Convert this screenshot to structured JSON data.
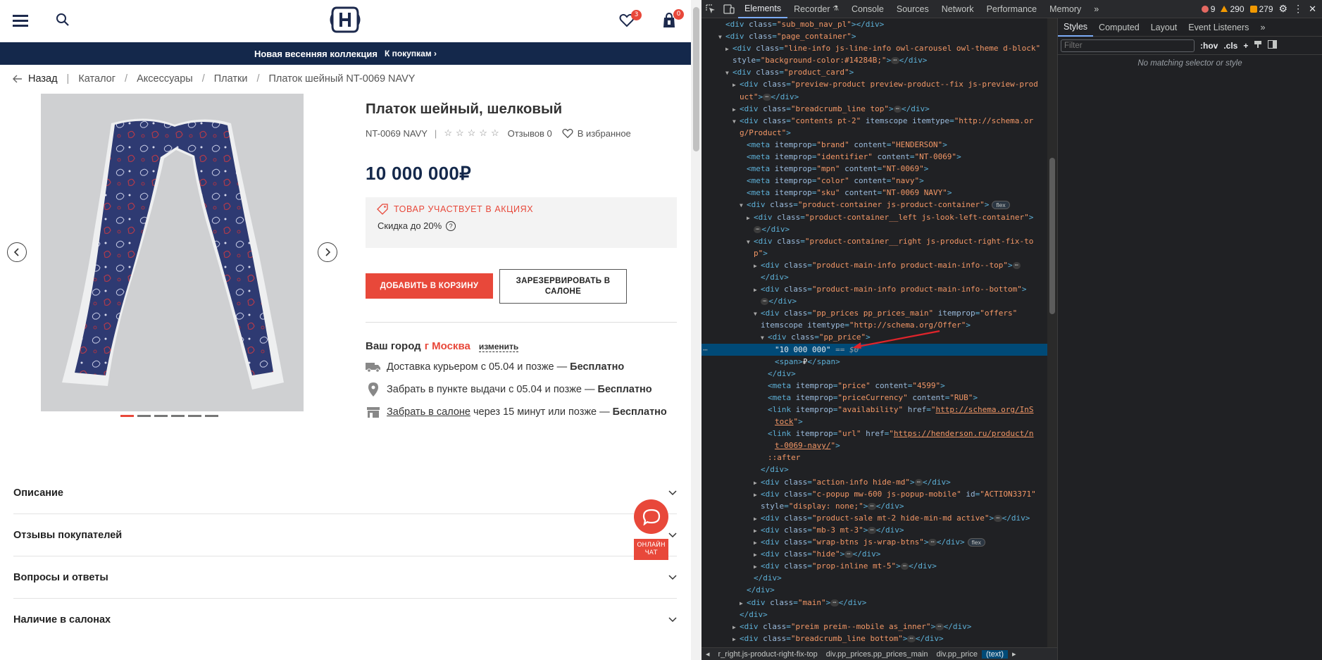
{
  "site": {
    "header": {
      "wishlist_count": "3",
      "cart_count": "0"
    },
    "promo_bar": {
      "text": "Новая весенняя коллекция",
      "link": "К покупкам"
    },
    "breadcrumbs": {
      "back": "Назад",
      "items": [
        "Каталог",
        "Аксессуары",
        "Платки",
        "Платок шейный NT-0069 NAVY"
      ]
    },
    "product": {
      "title": "Платок шейный, шелковый",
      "sku": "NT-0069 NAVY",
      "reviews": "Отзывов 0",
      "favorite": "В избранное",
      "rating_stars": 0,
      "price": "10 000 000₽",
      "promo_title": "ТОВАР УЧАСТВУЕТ В АКЦИЯХ",
      "promo_discount": "Скидка до 20%",
      "add_to_cart": "ДОБАВИТЬ В КОРЗИНУ",
      "reserve": "ЗАРЕЗЕРВИРОВАТЬ В САЛОНЕ",
      "city_label": "Ваш город",
      "city": "г Москва",
      "change_city": "изменить",
      "delivery": [
        {
          "icon": "truck-icon",
          "text": "Доставка курьером с 05.04 и позже — ",
          "bold": "Бесплатно"
        },
        {
          "icon": "pin-icon",
          "text": "Забрать в пункте выдачи с 05.04 и позже — ",
          "bold": "Бесплатно"
        },
        {
          "icon": "store-icon",
          "link": "Забрать в салоне",
          "text": " через 15 минут или позже — ",
          "bold": "Бесплатно"
        }
      ],
      "gallery_slides": 6,
      "gallery_active": 1
    },
    "accordions": [
      "Описание",
      "Отзывы покупателей",
      "Вопросы и ответы",
      "Наличие в салонах"
    ],
    "chat": {
      "label": "ОНЛАЙН ЧАТ"
    },
    "colors": {
      "brand_navy": "#14284b",
      "accent_red": "#e8483a"
    }
  },
  "devtools": {
    "tabs": [
      "Elements",
      "Recorder",
      "Console",
      "Sources",
      "Network",
      "Performance",
      "Memory"
    ],
    "active_tab": "Elements",
    "status": {
      "errors": "9",
      "warnings": "290",
      "issues": "279"
    },
    "styles_tabs": [
      "Styles",
      "Computed",
      "Layout",
      "Event Listeners"
    ],
    "filter_placeholder": "Filter",
    "hov": ":hov",
    "cls": ".cls",
    "styles_empty": "No matching selector or style",
    "breadcrumbs": [
      "r_right.js-product-right-fix-top",
      "div.pp_prices.pp_prices_main",
      "div.pp_price",
      "(text)"
    ]
  }
}
